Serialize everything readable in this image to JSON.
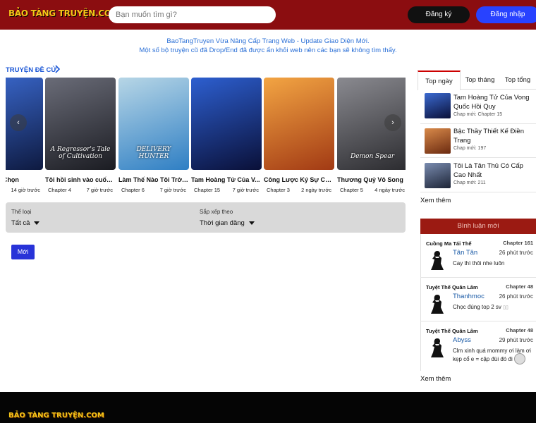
{
  "header": {
    "logo": "BẢO TÀNG TRUYỆN.COM",
    "search_placeholder": "Bạn muốn tìm gì?",
    "register_label": "Đăng ký",
    "login_label": "Đăng nhập"
  },
  "notice": {
    "line1": "BaoTangTruyen Vừa Nâng Cấp Trang Web - Update Giao Diện Mới.",
    "line2": "Một số bộ truyện cũ đã Drop/End đã được ẩn khỏi web nên các bạn sẽ không tìm thấy."
  },
  "recommended": {
    "title": "TRUYỆN ĐỀ CỬ",
    "chevron_icon": "chevron-right-icon",
    "cards": [
      {
        "title": "Tôi Được Chọn",
        "chapter": "",
        "time": "14 giờ trước",
        "cover_text": "",
        "c1": "#0e1a40",
        "c2": "#3b6ad1"
      },
      {
        "title": "Tôi hồi sinh vào cuốn ...",
        "chapter": "Chapter 4",
        "time": "7 giờ trước",
        "cover_text": "A Regressor's Tale of Cultivation",
        "c1": "#1b1c22",
        "c2": "#6a6c78"
      },
      {
        "title": "Làm Thế Nào Tôi Trở T...",
        "chapter": "Chapter 6",
        "time": "7 giờ trước",
        "cover_text": "DELIVERY HUNTER",
        "c1": "#2f7fc4",
        "c2": "#b7d6e6"
      },
      {
        "title": "Tam Hoàng Tử Của V...",
        "chapter": "Chapter 15",
        "time": "7 giờ trước",
        "cover_text": "",
        "c1": "#0a1038",
        "c2": "#2d5fd0"
      },
      {
        "title": "Công Lược Ký Sự Của ...",
        "chapter": "Chapter 3",
        "time": "2 ngày trước",
        "cover_text": "",
        "c1": "#a23a14",
        "c2": "#f3a543"
      },
      {
        "title": "Thương Quỷ Vô Song",
        "chapter": "Chapter 5",
        "time": "4 ngày trước",
        "cover_text": "Demon Spear",
        "c1": "#2c2c30",
        "c2": "#8a8a90"
      }
    ],
    "prev_icon": "chevron-left-icon",
    "next_icon": "chevron-right-icon"
  },
  "filter": {
    "genre_label": "Thể loại",
    "genre_value": "Tất cả",
    "sort_label": "Sắp xếp theo",
    "sort_value": "Thời gian đăng"
  },
  "new_button": "Mới",
  "top": {
    "tabs": [
      "Top ngày",
      "Top tháng",
      "Top tổng"
    ],
    "items": [
      {
        "title": "Tam Hoàng Tử Của Vong Quốc Hồi Quy",
        "chapter": "Chap mới: Chapter 15",
        "c1": "#0a1038",
        "c2": "#3b6ad1"
      },
      {
        "title": "Bậc Thầy Thiết Kế Điền Trang",
        "chapter": "Chap mới: 197",
        "c1": "#6b2a10",
        "c2": "#d98a4a"
      },
      {
        "title": "Tôi Là Tân Thủ Có Cấp Cao Nhất",
        "chapter": "Chap mới: 211",
        "c1": "#1c2436",
        "c2": "#7a8cb0"
      }
    ],
    "more_label": "Xem thêm"
  },
  "comments": {
    "header": "Bình luận mới",
    "items": [
      {
        "story": "Cuồng Ma Tái Thế",
        "chapter": "Chapter 161",
        "user": "Tân Tân",
        "time": "26 phút trước",
        "text": "Cay thì thôi nhe luôn"
      },
      {
        "story": "Tuyệt Thế Quân Lâm",
        "chapter": "Chapter 48",
        "user": "Thanhmoc",
        "time": "26 phút trước",
        "text": "Chọc đúng top 2 sv"
      },
      {
        "story": "Tuyệt Thế Quân Lâm",
        "chapter": "Chapter 48",
        "user": "Abyss",
        "time": "29 phút trước",
        "text": "Clm xinh quá mommy ơi làm ơi kẹp cổ e = cặp đùi đó đi"
      }
    ],
    "more_label": "Xem thêm"
  },
  "footer": {
    "logo": "BẢO TÀNG TRUYỆN.COM"
  }
}
